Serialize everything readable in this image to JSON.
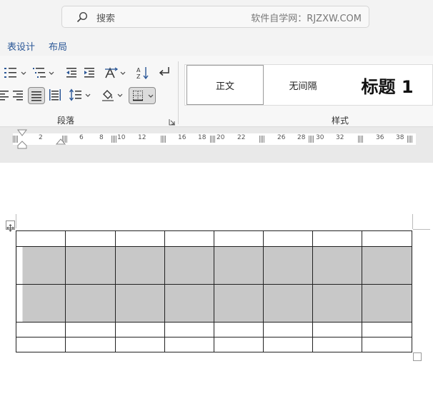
{
  "search": {
    "placeholder": "搜索",
    "watermark": "软件自学网：RJZXW.COM"
  },
  "tabs": [
    {
      "label": "表设计"
    },
    {
      "label": "布局"
    }
  ],
  "ribbon": {
    "paragraph_group_label": "段落",
    "styles_group_label": "样式",
    "styles": [
      {
        "label": "正文"
      },
      {
        "label": "无间隔"
      },
      {
        "label": "标题 1"
      }
    ]
  },
  "ruler": {
    "ticks": [
      "2",
      "6",
      "8",
      "10",
      "12",
      "16",
      "18",
      "20",
      "22",
      "26",
      "28",
      "30",
      "32",
      "36",
      "38"
    ]
  },
  "table": {
    "rows": 5,
    "columns": 8,
    "shaded_rows": [
      2,
      3
    ]
  }
}
